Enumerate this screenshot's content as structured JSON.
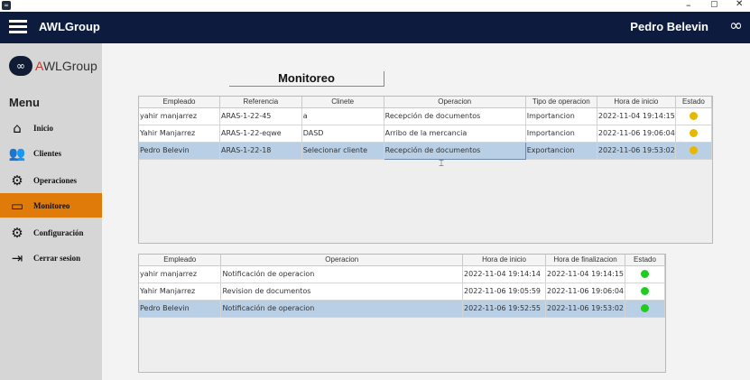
{
  "app": {
    "title": "AWLGroup",
    "user": "Pedro Belevin"
  },
  "window": {
    "minimize": "–",
    "maximize": "▢",
    "close": "✕"
  },
  "logo": {
    "mark": "∞",
    "a": "A",
    "text": "WLGroup"
  },
  "sidebar": {
    "menu_title": "Menu",
    "items": [
      {
        "label": "Inicio",
        "icon": "home-icon",
        "glyph": "⌂"
      },
      {
        "label": "Clientes",
        "icon": "users-icon",
        "glyph": "👥"
      },
      {
        "label": "Operaciones",
        "icon": "gears-icon",
        "glyph": "⚙"
      },
      {
        "label": "Monitoreo",
        "icon": "monitor-icon",
        "glyph": "▭",
        "active": true
      },
      {
        "label": "Configuración",
        "icon": "settings-icon",
        "glyph": "⚙"
      },
      {
        "label": "Cerrar sesion",
        "icon": "logout-icon",
        "glyph": "⇥"
      }
    ]
  },
  "page_title": "Monitoreo",
  "colors": {
    "accent": "#e07b0a",
    "header": "#0d1c3e",
    "status_pending": "#e6b800",
    "status_done": "#1fcc1f",
    "selected_row": "#b8cfe6"
  },
  "table1": {
    "headers": [
      "Empleado",
      "Referencia",
      "Clinete",
      "Operacion",
      "Tipo de operacion",
      "Hora de inicio",
      "Estado"
    ],
    "rows": [
      {
        "empleado": "yahir manjarrez",
        "referencia": "ARAS-1-22-45",
        "cliente": "a",
        "operacion": "Recepción de documentos",
        "tipo": "Importancion",
        "hora": "2022-11-04 19:14:15",
        "estado": "pending"
      },
      {
        "empleado": "Yahir  Manjarrez",
        "referencia": "ARAS-1-22-eqwe",
        "cliente": "DASD",
        "operacion": "Arribo de la mercancia",
        "tipo": "Importancion",
        "hora": "2022-11-06 19:06:04",
        "estado": "pending"
      },
      {
        "empleado": "Pedro Belevin",
        "referencia": "ARAS-1-22-18",
        "cliente": "Selecionar cliente",
        "operacion": "Recepción de documentos",
        "tipo": "Exportancion",
        "hora": "2022-11-06 19:53:02",
        "estado": "pending",
        "selected": true
      }
    ]
  },
  "table2": {
    "headers": [
      "Empleado",
      "Operacion",
      "Hora de inicio",
      "Hora de finalizacion",
      "Estado"
    ],
    "rows": [
      {
        "empleado": "yahir manjarrez",
        "operacion": "Notificación de operacion",
        "inicio": "2022-11-04 19:14:14",
        "fin": "2022-11-04 19:14:15",
        "estado": "done"
      },
      {
        "empleado": "Yahir  Manjarrez",
        "operacion": "Revision de documentos",
        "inicio": "2022-11-06 19:05:59",
        "fin": "2022-11-06 19:06:04",
        "estado": "done"
      },
      {
        "empleado": "Pedro Belevin",
        "operacion": "Notificación de operacion",
        "inicio": "2022-11-06 19:52:55",
        "fin": "2022-11-06 19:53:02",
        "estado": "done",
        "selected": true
      }
    ]
  }
}
